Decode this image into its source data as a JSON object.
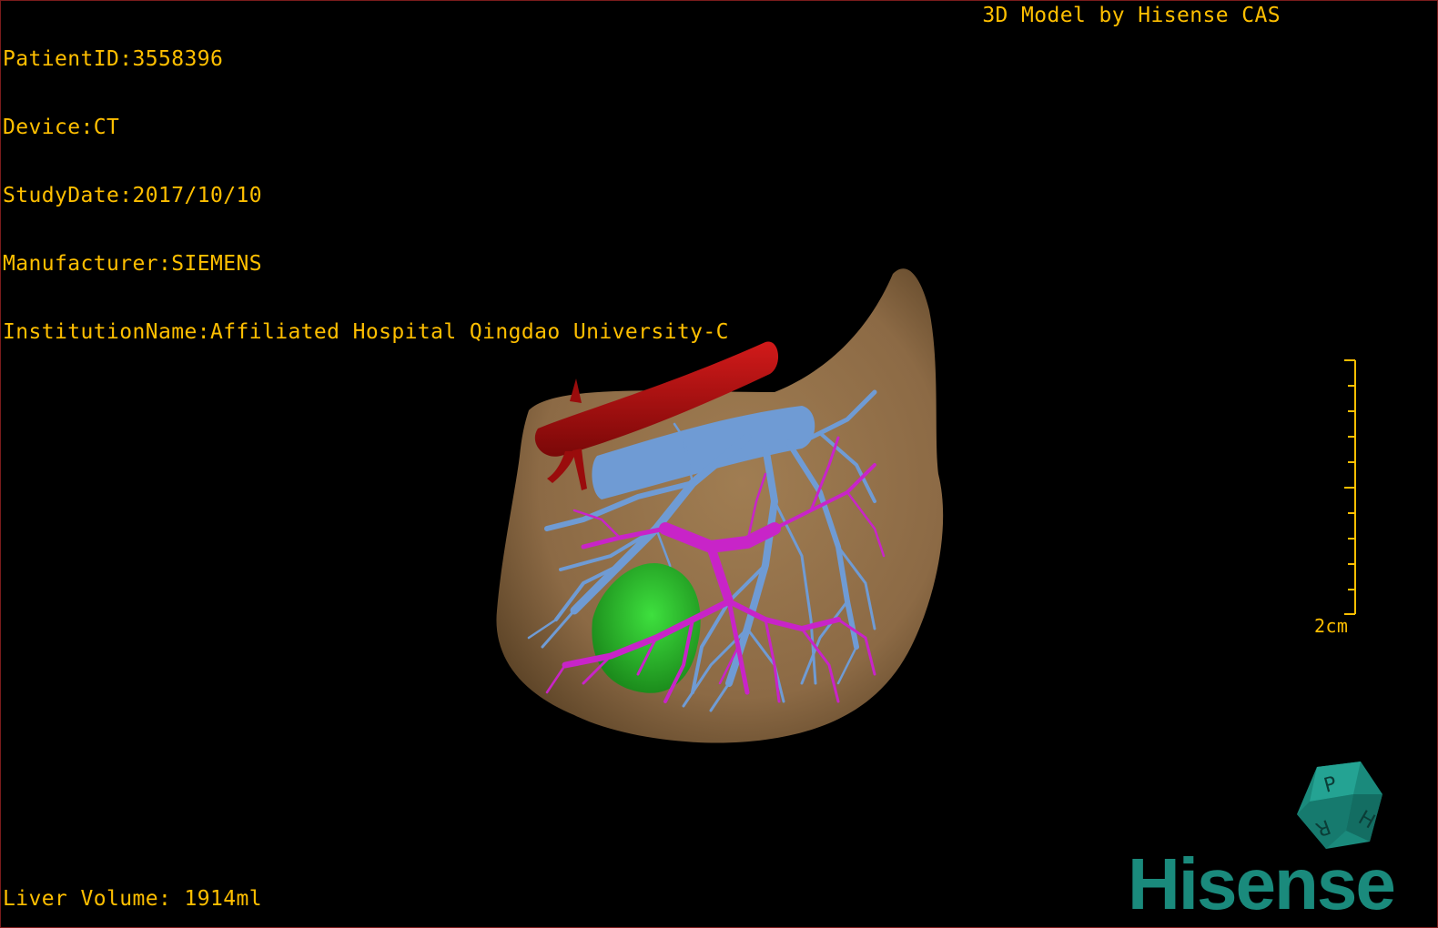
{
  "study_info": {
    "patient_id": "PatientID:3558396",
    "device": "Device:CT",
    "study_date": "StudyDate:2017/10/10",
    "manufacturer": "Manufacturer:SIEMENS",
    "institution": "InstitutionName:Affiliated Hospital Qingdao University-C"
  },
  "credit": "3D Model by Hisense CAS",
  "liver_volume": "Liver Volume: 1914ml",
  "scale": {
    "label": "2cm"
  },
  "orientation_cube": {
    "face_labels": [
      "P",
      "H",
      "R"
    ]
  },
  "brand": {
    "name": "Hisense"
  },
  "colors": {
    "overlay_text": "#ffbf00",
    "liver": "#8c6a45",
    "artery": "#b50e0e",
    "hepatic_vein": "#6f9bd4",
    "portal_vein": "#c824c8",
    "tumor": "#2fc22f",
    "brand": "#1a8a7c"
  }
}
